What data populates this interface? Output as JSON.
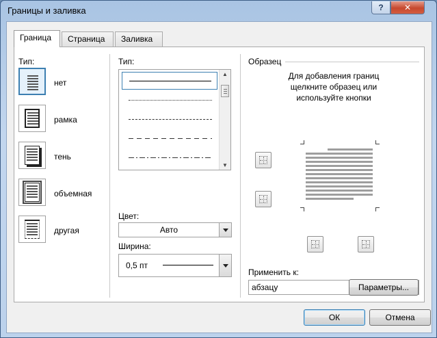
{
  "window": {
    "title": "Границы и заливка",
    "help_label": "?",
    "close_label": "✕"
  },
  "tabs": [
    {
      "label": "Граница",
      "active": true
    },
    {
      "label": "Страница",
      "active": false
    },
    {
      "label": "Заливка",
      "active": false
    }
  ],
  "settings": {
    "label": "Тип:",
    "items": [
      {
        "label": "нет",
        "icon": "setting-none-icon",
        "selected": true
      },
      {
        "label": "рамка",
        "icon": "setting-box-icon",
        "selected": false
      },
      {
        "label": "тень",
        "icon": "setting-shadow-icon",
        "selected": false
      },
      {
        "label": "объемная",
        "icon": "setting-3d-icon",
        "selected": false
      },
      {
        "label": "другая",
        "icon": "setting-custom-icon",
        "selected": false
      }
    ]
  },
  "style": {
    "label": "Тип:",
    "items": [
      "solid",
      "dotted",
      "dashed-small",
      "dashed-large",
      "dash-dot"
    ],
    "selected_index": 0
  },
  "color": {
    "label": "Цвет:",
    "value": "Авто"
  },
  "width": {
    "label": "Ширина:",
    "value": "0,5 пт"
  },
  "preview": {
    "label": "Образец",
    "instructions": [
      "Для добавления границ",
      "щелкните образец или",
      "используйте кнопки"
    ]
  },
  "apply_to": {
    "label": "Применить к:",
    "value": "абзацу"
  },
  "buttons": {
    "options": "Параметры...",
    "ok": "ОК",
    "cancel": "Отмена"
  },
  "colors": {
    "accent": "#3c7fb1",
    "close": "#c7492f"
  }
}
